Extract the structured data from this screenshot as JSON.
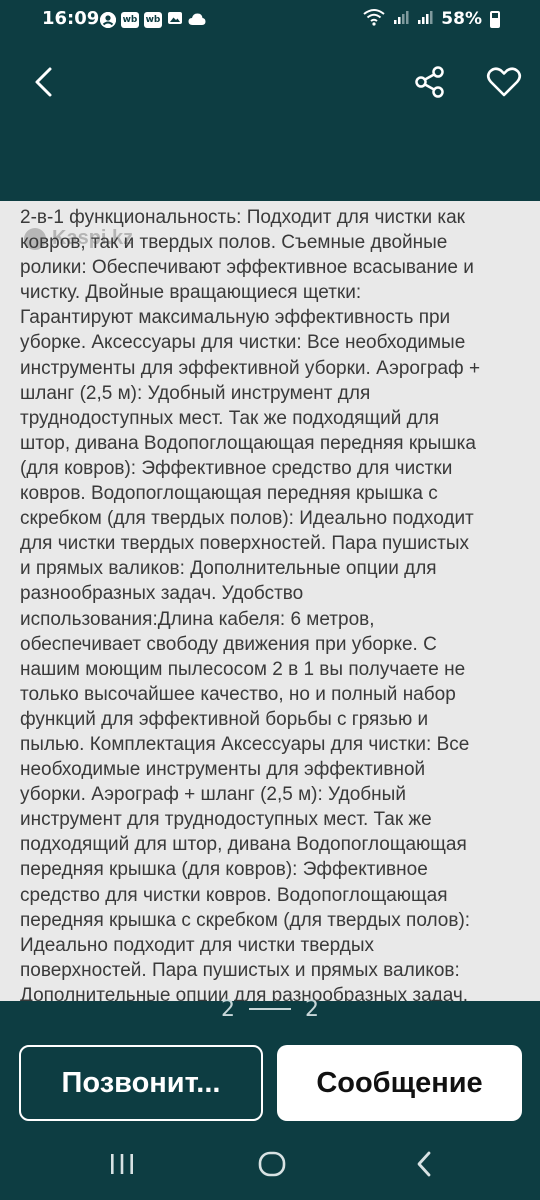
{
  "status_bar": {
    "time": "16:09",
    "notification_icons": [
      "account-circle-icon",
      "wb-app-icon",
      "wb-app-icon",
      "image-icon",
      "cloud-icon"
    ],
    "wb_label": "wb",
    "battery": "58%",
    "battery_level": 0.58,
    "system_icons": [
      "wifi-icon",
      "signal-icon",
      "signal-icon"
    ]
  },
  "toolbar": {
    "back_icon": "chevron-left-icon",
    "share_icon": "share-icon",
    "favorite_icon": "heart-outline-icon"
  },
  "gallery": {
    "watermark": "Kaspi.kz",
    "description": "2-в-1 функциональность: Подходит для чистки как\nковров, так и твердых полов. Съемные двойные\nролики: Обеспечивают эффективное всасывание и\nчистку. Двойные вращающиеся щетки:\nГарантируют максимальную эффективность при\nуборке. Аксессуары для чистки: Все необходимые\nинструменты для эффективной уборки. Аэрограф +\nшланг (2,5 м): Удобный инструмент для\nтруднодоступных мест. Так же подходящий для\nштор, дивана Водопоглощающая передняя крышка\n(для ковров): Эффективное средство для чистки\nковров. Водопоглощающая передняя крышка с\nскребком (для твердых полов): Идеально подходит\nдля чистки твердых поверхностей. Пара пушистых\nи прямых валиков: Дополнительные опции для\nразнообразных задач. Удобство\nиспользования:Длина кабеля: 6 метров,\nобеспечивает свободу движения при уборке. С\nнашим моющим пылесосом 2 в 1 вы получаете не\nтолько высочайшее качество, но и полный набор\nфункций для эффективной борьбы с грязью и\nпылью. Комплектация Аксессуары для чистки: Все\nнеобходимые инструменты для эффективной\nуборки. Аэрограф + шланг (2,5 м): Удобный\nинструмент для труднодоступных мест. Так же\nподходящий для штор, дивана Водопоглощающая\nпередняя крышка (для ковров): Эффективное\nсредство для чистки ковров. Водопоглощающая\nпередняя крышка с скребком (для твердых полов):\nИдеально подходит для чистки твердых\nповерхностей. Пара пушистых и прямых валиков:\nДополнительные опции для разнообразных задач."
  },
  "pager": {
    "current": "2",
    "total": "2"
  },
  "actions": {
    "call_label": "Позвонит...",
    "message_label": "Сообщение"
  },
  "nav_bar": {
    "recents_icon": "recents-icon",
    "home_icon": "home-icon",
    "back_icon": "back-icon"
  },
  "colors": {
    "background": "#0d3d42",
    "image_background": "#e9e9e9",
    "text_on_image": "#3a3a3a",
    "button_primary_bg": "#ffffff"
  }
}
